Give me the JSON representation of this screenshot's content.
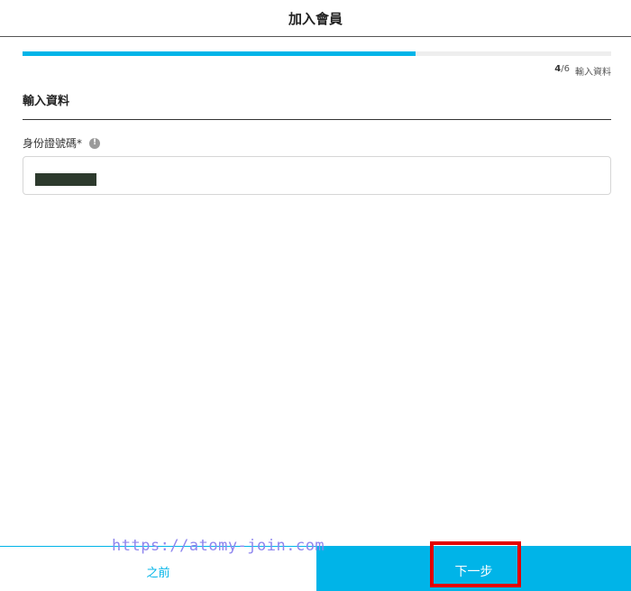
{
  "header": {
    "title": "加入會員"
  },
  "progress": {
    "current_step": "4",
    "total_steps": "/6",
    "fraction": 0.667,
    "step_label": "輸入資料",
    "accent_color": "#00b4e8"
  },
  "section": {
    "title": "輸入資料"
  },
  "form": {
    "id_field": {
      "label": "身份證號碼*",
      "info_icon": "info-icon",
      "info_glyph": "!",
      "value_redacted": true
    }
  },
  "footer": {
    "prev_label": "之前",
    "next_label": "下一步"
  },
  "watermark": {
    "text": "https://atomy-join.com"
  }
}
